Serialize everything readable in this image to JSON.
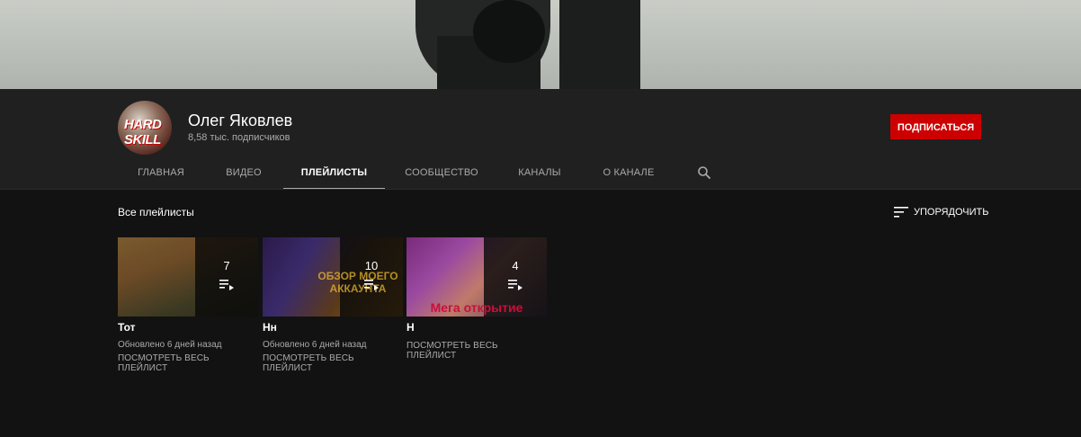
{
  "channel": {
    "name": "Олег Яковлев",
    "subscribers": "8,58 тыс. подписчиков",
    "avatar_text_1": "HARD",
    "avatar_text_2": "SKILL",
    "subscribe_label": "ПОДПИСАТЬСЯ",
    "subscribe_color": "#cc0000"
  },
  "tabs": [
    {
      "label": "ГЛАВНАЯ",
      "active": false
    },
    {
      "label": "ВИДЕО",
      "active": false
    },
    {
      "label": "ПЛЕЙЛИСТЫ",
      "active": true
    },
    {
      "label": "СООБЩЕСТВО",
      "active": false
    },
    {
      "label": "КАНАЛЫ",
      "active": false
    },
    {
      "label": "О КАНАЛЕ",
      "active": false
    }
  ],
  "search_icon": "search-icon",
  "section": {
    "title": "Все плейлисты",
    "sort_label": "УПОРЯДОЧИТЬ",
    "sort_icon": "sort-icon"
  },
  "playlists": [
    {
      "title": "Тот",
      "count": "7",
      "updated": "Обновлено 6 дней назад",
      "view_all": "ПОСМОТРЕТЬ ВЕСЬ ПЛЕЙЛИСТ"
    },
    {
      "title": "Нн",
      "count": "10",
      "updated": "Обновлено 6 дней назад",
      "view_all": "ПОСМОТРЕТЬ ВЕСЬ ПЛЕЙЛИСТ",
      "thumb_text": "ОБЗОР МОЕГО АККАУНТА"
    },
    {
      "title": "Н",
      "count": "4",
      "updated": "",
      "view_all": "ПОСМОТРЕТЬ ВЕСЬ ПЛЕЙЛИСТ",
      "thumb_text": "Мега открытие"
    }
  ],
  "playlist_icon": "playlist-icon"
}
